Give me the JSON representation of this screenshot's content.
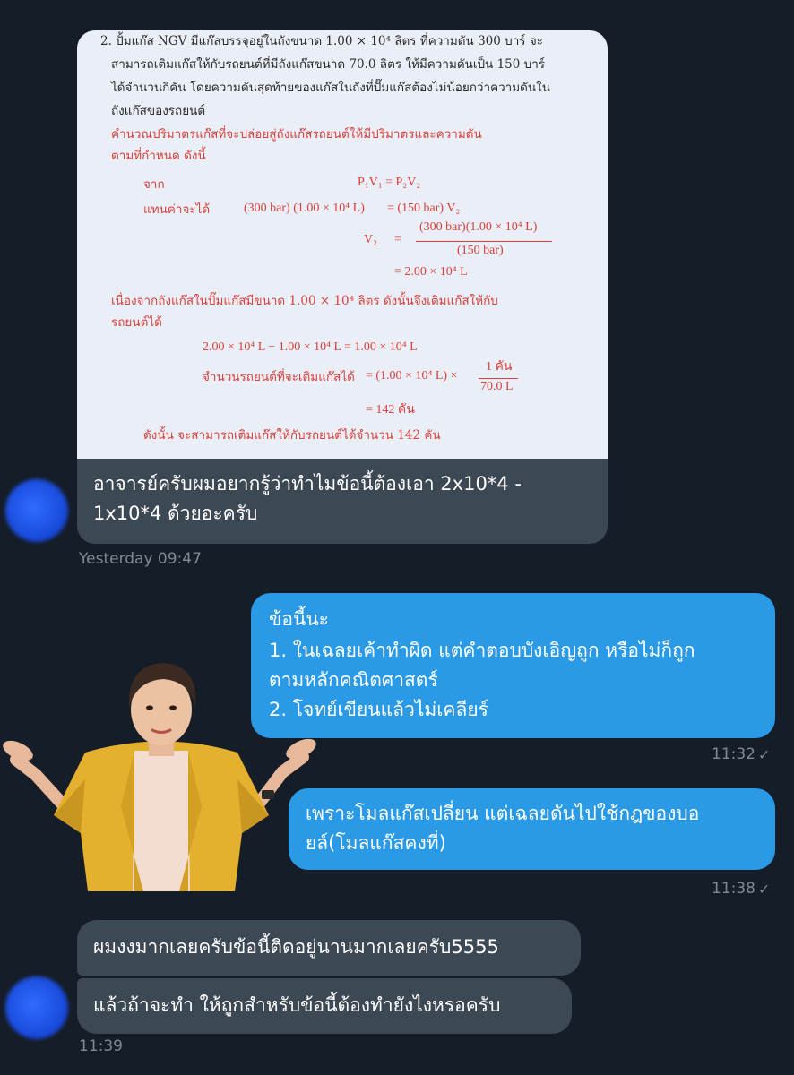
{
  "attachment": {
    "problem_lines": [
      "2. ปั้มแก๊ส NGV มีแก๊สบรรจุอยู่ในถังขนาด 1.00 × 10⁴ ลิตร ที่ความดัน 300 บาร์ จะ",
      "สามารถเติมแก๊สให้กับรถยนต์ที่มีถังแก๊สขนาด 70.0 ลิตร ให้มีความดันเป็น 150 บาร์",
      "ได้จำนวนกี่คัน โดยความดันสุดท้ายของแก๊สในถังที่ปั๊มแก๊สต้องไม่น้อยกว่าความดันใน",
      "ถังแก๊สของรถยนต์"
    ],
    "method_lines": [
      "คำนวณปริมาตรแก๊สที่จะปล่อยสู่ถังแก๊สรถยนต์ให้มีปริมาตรและความดัน",
      "ตามที่กำหนด ดังนี้"
    ],
    "label_from": "จาก",
    "eq1_right": "P₁V₁  =  P₂V₂",
    "label_substitute": "แทนค่าจะได้",
    "eq2_left": "(300 bar) (1.00 × 10⁴ L)",
    "eq2_right": "=  (150 bar) V₂",
    "v2_label": "V₂",
    "eq3_eq": "=",
    "eq3_num": "(300 bar)(1.00 × 10⁴ L)",
    "eq3_den": "(150 bar)",
    "eq4": "=  2.00 × 10⁴ L",
    "because_lines": [
      "เนื่องจากถังแก๊สในปั๊มแก๊สมีขนาด 1.00 × 10⁴ ลิตร ดังนั้นจึงเติมแก๊สให้กับ",
      "รถยนต์ได้"
    ],
    "eq5": "2.00 × 10⁴ L − 1.00 × 10⁴ L  =  1.00 × 10⁴ L",
    "cars_label": "จำนวนรถยนต์ที่จะเติมแก๊สได้",
    "eq6_left": "=  (1.00 × 10⁴ L) ×",
    "eq6_num": "1 คัน",
    "eq6_den": "70.0 L",
    "eq7": "=  142 คัน",
    "conclusion": "ดังนั้น  จะสามารถเติมแก๊สให้กับรถยนต์ได้จำนวน 142 คัน"
  },
  "messages": {
    "m1_text": "อาจารย์ครับผมอยากรู้ว่าทำไมข้อนี้ต้องเอา 2x10*4 - 1x10*4 ด้วยอะครับ",
    "m1_time": "Yesterday 09:47",
    "m2_lines": [
      "ข้อนี้นะ",
      "1. ในเฉลยเค้าทำผิด แต่คำตอบบังเอิญถูก หรือไม่ก็ถูก",
      "ตามหลักคณิตศาสตร์",
      "2. โจทย์เขียนแล้วไม่เคลียร์"
    ],
    "m2_time": "11:32",
    "m3_text": "เพราะโมลแก๊สเปลี่ยน แต่เฉลยดันไปใช้กฎของบอยล์(โมลแก๊สคงที่)",
    "m3_time": "11:38",
    "m4_text": "ผมงงมากเลยครับข้อนี้ติดอยู่นานมากเลยครับ5555",
    "m5_text": "แล้วถ้าจะทำ ให้ถูกสำหรับข้อนี้ต้องทำยังไงหรอครับ",
    "m5_time": "11:39",
    "read_mark": "✓"
  },
  "colors": {
    "background": "#151d28",
    "incoming_bubble": "#3d4855",
    "outgoing_bubble": "#2a9ae6",
    "timestamp": "#808892",
    "textbook_red": "#d8413c"
  }
}
